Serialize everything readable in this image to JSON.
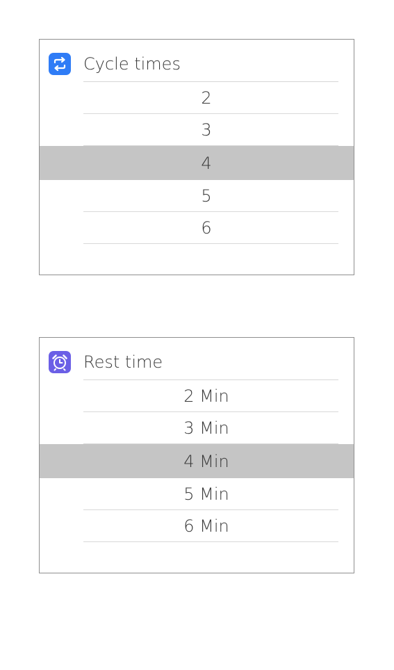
{
  "cycle": {
    "title": "Cycle times",
    "icon": "repeat-icon",
    "accent": "#2f7cf6",
    "selected": "4",
    "options": [
      "2",
      "3",
      "4",
      "5",
      "6"
    ]
  },
  "rest": {
    "title": "Rest time",
    "icon": "alarm-clock-icon",
    "accent": "#6b5fe6",
    "selected": "4 Min",
    "options": [
      "2 Min",
      "3 Min",
      "4 Min",
      "5 Min",
      "6 Min"
    ]
  },
  "selection_color": "#c5c5c5"
}
